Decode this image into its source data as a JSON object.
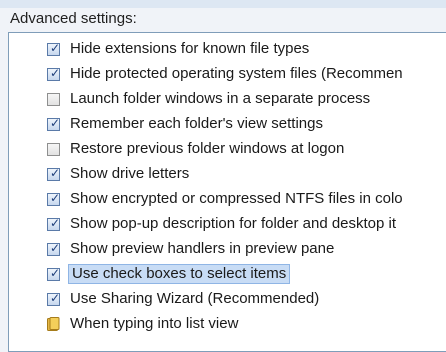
{
  "heading": "Advanced settings:",
  "items": [
    {
      "label": "Hide extensions for known file types",
      "checked": true
    },
    {
      "label": "Hide protected operating system files (Recommen",
      "checked": true
    },
    {
      "label": "Launch folder windows in a separate process",
      "checked": false
    },
    {
      "label": "Remember each folder's view settings",
      "checked": true
    },
    {
      "label": "Restore previous folder windows at logon",
      "checked": false
    },
    {
      "label": "Show drive letters",
      "checked": true
    },
    {
      "label": "Show encrypted or compressed NTFS files in colo",
      "checked": true
    },
    {
      "label": "Show pop-up description for folder and desktop it",
      "checked": true
    },
    {
      "label": "Show preview handlers in preview pane",
      "checked": true
    },
    {
      "label": "Use check boxes to select items",
      "checked": true,
      "selected": true
    },
    {
      "label": "Use Sharing Wizard (Recommended)",
      "checked": true
    }
  ],
  "folder_item": {
    "label": "When typing into list view",
    "icon": "folder-icon"
  },
  "colors": {
    "selection_bg": "#c8dcf5",
    "selection_border": "#8fb5e5",
    "list_border": "#7f9db9"
  }
}
